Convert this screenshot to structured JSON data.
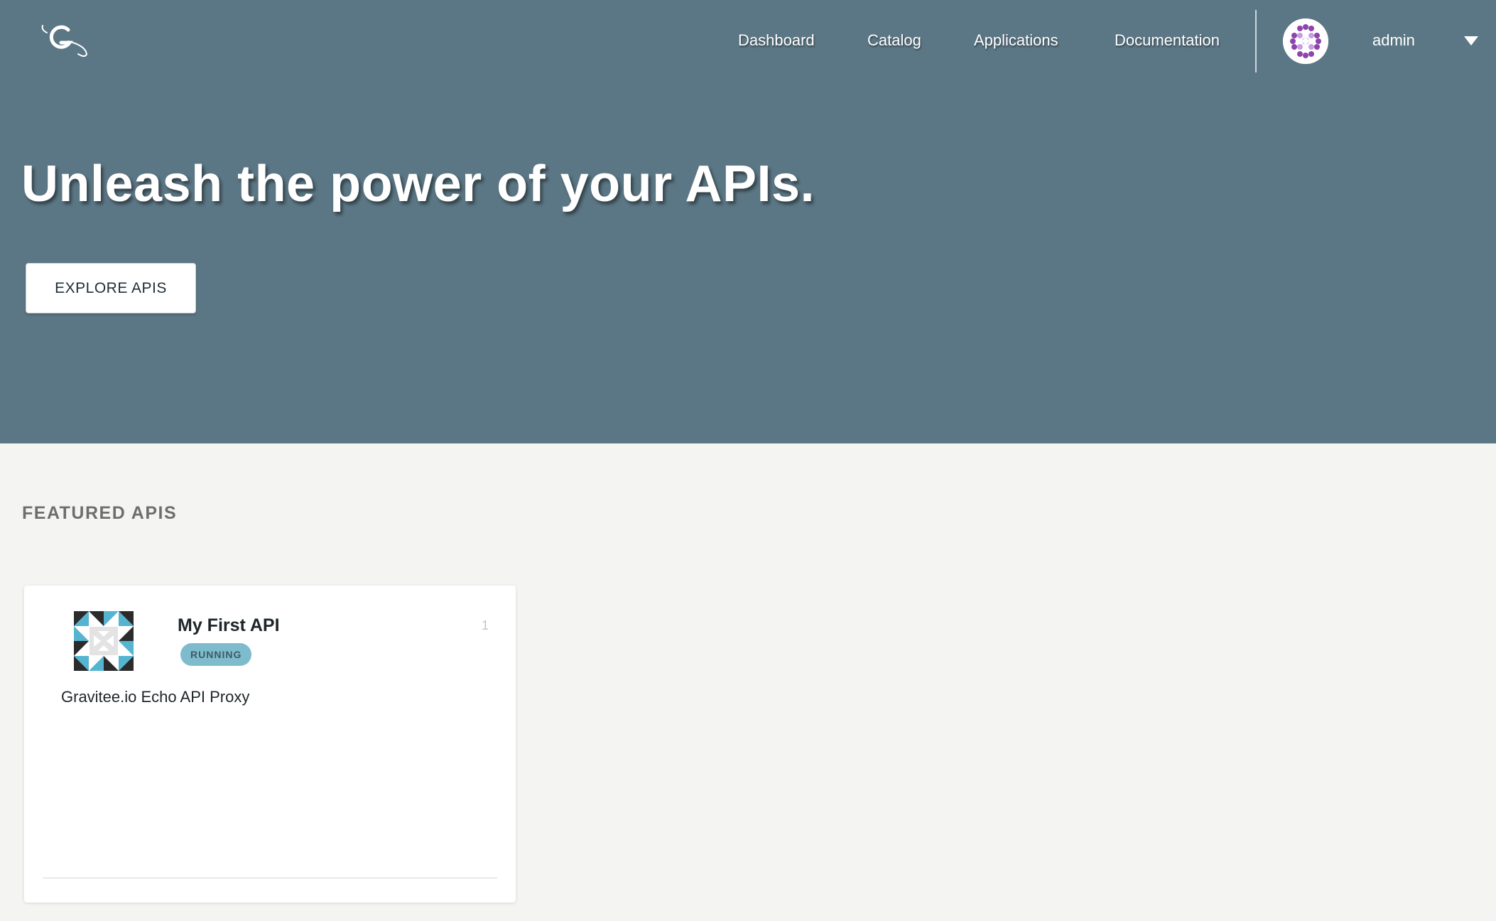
{
  "nav": {
    "links": [
      "Dashboard",
      "Catalog",
      "Applications",
      "Documentation"
    ],
    "username": "admin"
  },
  "hero": {
    "title": "Unleash the power of your APIs.",
    "cta_label": "EXPLORE APIS"
  },
  "featured": {
    "section_title": "FEATURED APIS",
    "cards": [
      {
        "name": "My First API",
        "status": "RUNNING",
        "version": "1",
        "description": "Gravitee.io Echo API Proxy"
      }
    ]
  },
  "colors": {
    "hero_bg": "#5b7684",
    "page_bg": "#f4f4f3",
    "badge_bg": "#7ebccd",
    "avatar_accent": "#8e44ad"
  }
}
